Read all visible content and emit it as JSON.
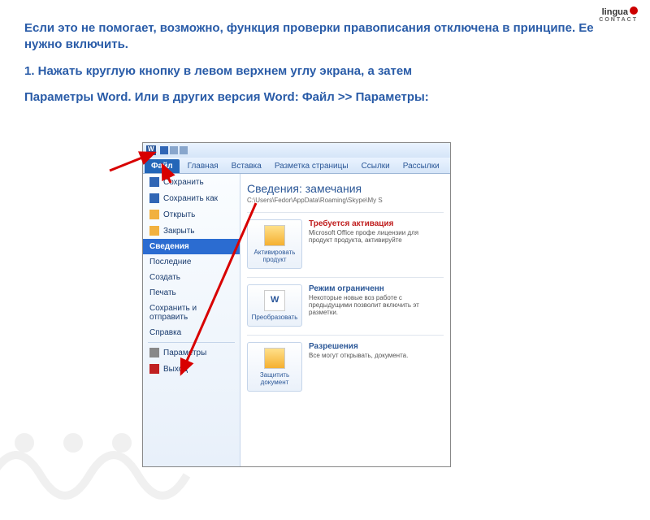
{
  "logo": {
    "brand": "lingua",
    "sub": "CONTACT"
  },
  "instructions": {
    "p1": "Если это не помогает, возможно, функция проверки правописания отключена в принципе. Ее нужно включить.",
    "p2": "1. Нажать круглую кнопку в левом верхнем углу экрана, а затем",
    "p3": "Параметры Word. Или в других версия Word: Файл >> Параметры:"
  },
  "ribbon": {
    "file": "Файл",
    "home": "Главная",
    "insert": "Вставка",
    "layout": "Разметка страницы",
    "refs": "Ссылки",
    "mail": "Рассылки"
  },
  "sidebar": {
    "save": "Сохранить",
    "saveas": "Сохранить как",
    "open": "Открыть",
    "close": "Закрыть",
    "info": "Сведения",
    "recent": "Последние",
    "new": "Создать",
    "print": "Печать",
    "share": "Сохранить и отправить",
    "help": "Справка",
    "options": "Параметры",
    "exit": "Выход"
  },
  "content": {
    "title": "Сведения: замечания",
    "path": "C:\\Users\\Fedor\\AppData\\Roaming\\Skype\\My S",
    "activate": {
      "btn": "Активировать продукт",
      "title": "Требуется активация",
      "desc": "Microsoft Office профе лицензии для продукт продукта, активируйте"
    },
    "convert": {
      "btn": "Преобразовать",
      "title": "Режим ограниченн",
      "desc": "Некоторые новые воз работе с предыдущими позволит включить эт разметки."
    },
    "protect": {
      "btn": "Защитить документ",
      "title": "Разрешения",
      "desc": "Все могут открывать, документа."
    }
  }
}
